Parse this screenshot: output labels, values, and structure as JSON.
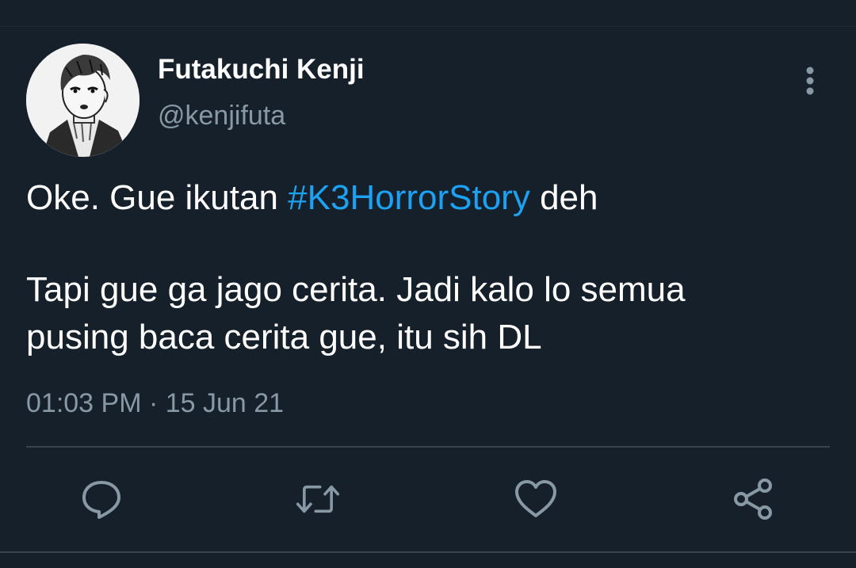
{
  "tweet": {
    "author": {
      "display_name": "Futakuchi Kenji",
      "handle": "@kenjifuta"
    },
    "text": {
      "line1_before": "Oke. Gue ikutan ",
      "hashtag": "#K3HorrorStory",
      "line1_after": " deh",
      "line2": "Tapi gue ga jago cerita. Jadi kalo lo semua",
      "line3": "pusing baca cerita gue, itu sih DL"
    },
    "timestamp": "01:03 PM · 15 Jun 21"
  },
  "actions": {
    "icons": [
      "reply-icon",
      "retweet-icon",
      "like-icon",
      "share-icon"
    ]
  },
  "colors": {
    "background": "#15202b",
    "text": "#ffffff",
    "secondary_text": "#8899a6",
    "link": "#1da1f2",
    "divider": "#38444d"
  }
}
